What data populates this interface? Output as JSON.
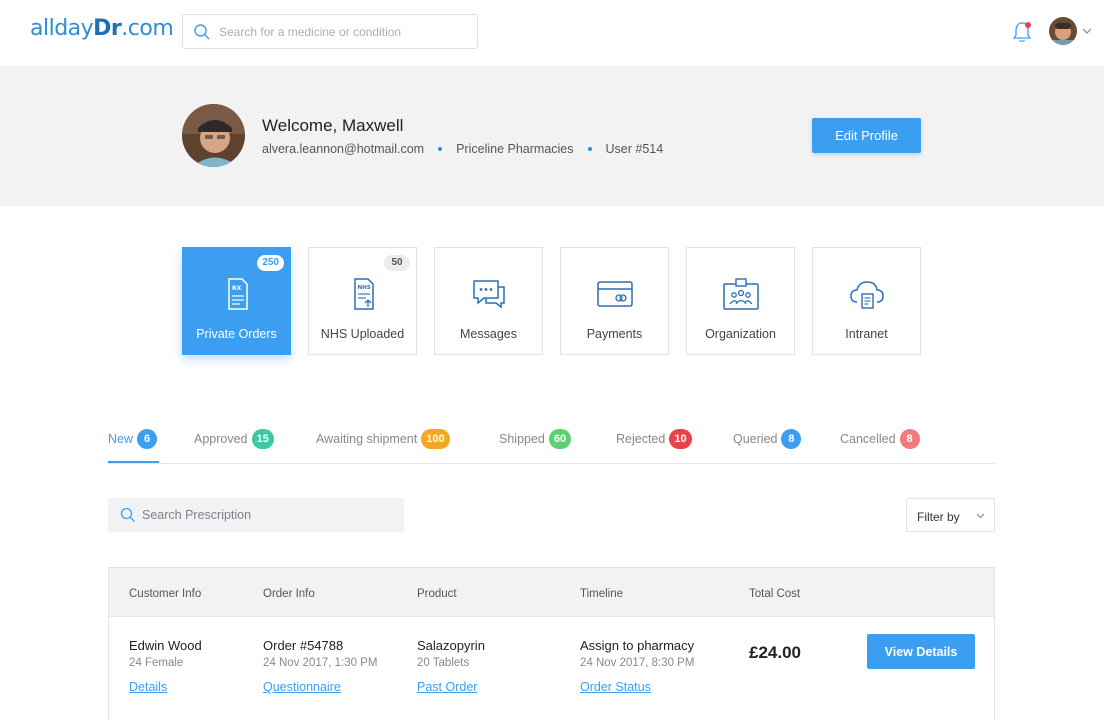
{
  "header": {
    "logo_prefix": "allday",
    "logo_dr": "Dr",
    "logo_suffix": ".com",
    "search_placeholder": "Search for a medicine or condition"
  },
  "profile": {
    "welcome": "Welcome, Maxwell",
    "email": "alvera.leannon@hotmail.com",
    "pharmacy": "Priceline Pharmacies",
    "user_id": "User #514",
    "edit_label": "Edit Profile"
  },
  "tiles": [
    {
      "label": "Private Orders",
      "badge": "250",
      "icon": "rx-document-icon",
      "active": true
    },
    {
      "label": "NHS Uploaded",
      "badge": "50",
      "icon": "nhs-upload-icon",
      "active": false
    },
    {
      "label": "Messages",
      "badge": "",
      "icon": "chat-bubbles-icon",
      "active": false
    },
    {
      "label": "Payments",
      "badge": "",
      "icon": "credit-card-icon",
      "active": false
    },
    {
      "label": "Organization",
      "badge": "",
      "icon": "organization-badge-icon",
      "active": false
    },
    {
      "label": "Intranet",
      "badge": "",
      "icon": "cloud-document-icon",
      "active": false
    }
  ],
  "status_tabs": [
    {
      "label": "New",
      "count": "6",
      "color": "#3c9ef0"
    },
    {
      "label": "Approved",
      "count": "15",
      "color": "#3ec7a4"
    },
    {
      "label": "Awaiting shipment",
      "count": "100",
      "color": "#f5a623"
    },
    {
      "label": "Shipped",
      "count": "60",
      "color": "#5cd16e"
    },
    {
      "label": "Rejected",
      "count": "10",
      "color": "#e8424b"
    },
    {
      "label": "Queried",
      "count": "8",
      "color": "#3c9ef0"
    },
    {
      "label": "Cancelled",
      "count": "8",
      "color": "#f07b7b"
    }
  ],
  "search_rx_placeholder": "Search Prescription",
  "filter_label": "Filter by",
  "table": {
    "headers": [
      "Customer Info",
      "Order Info",
      "Product",
      "Timeline",
      "Total Cost"
    ],
    "rows": [
      {
        "customer_name": "Edwin Wood",
        "customer_meta": "24 Female",
        "customer_link": "Details",
        "order_id": "Order #54788",
        "order_date": "24 Nov 2017, 1:30 PM",
        "order_link": "Questionnaire",
        "product_name": "Salazopyrin",
        "product_qty": "20 Tablets",
        "product_link": "Past Order",
        "timeline_status": "Assign to pharmacy",
        "timeline_date": "24 Nov 2017, 8:30 PM",
        "timeline_link": "Order Status",
        "total_cost": "£24.00",
        "action_label": "View Details"
      }
    ]
  },
  "colors": {
    "accent": "#3c9ef0",
    "band_bg": "#f2f2f3"
  }
}
